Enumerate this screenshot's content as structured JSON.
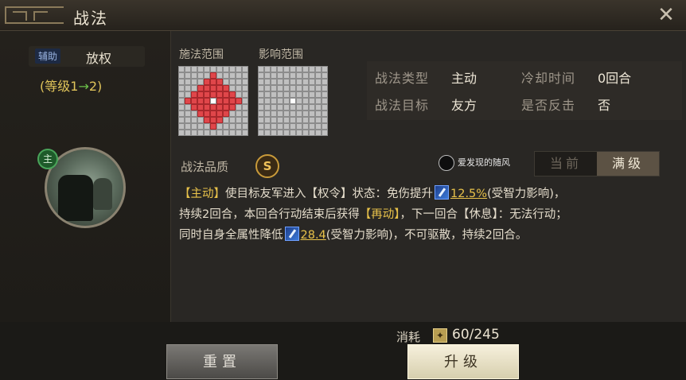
{
  "window": {
    "title": "战法",
    "close_icon": "close-icon"
  },
  "skill": {
    "type_badge": "辅助",
    "name": "放权",
    "level_prefix": "(等级1",
    "level_arrow": "→",
    "level_suffix": "2)",
    "leader_badge": "主"
  },
  "ranges": {
    "cast_label": "施法范围",
    "effect_label": "影响范围",
    "cast_grid_size": 11,
    "effect_grid_size": 11
  },
  "info": {
    "type_label": "战法类型",
    "type_value": "主动",
    "cooldown_label": "冷却时间",
    "cooldown_value": "0回合",
    "target_label": "战法目标",
    "target_value": "友方",
    "counter_label": "是否反击",
    "counter_value": "否"
  },
  "quality": {
    "label": "战法品质",
    "grade": "S"
  },
  "watermark": {
    "text": "爱发现的随风"
  },
  "level_toggle": {
    "current": "当前",
    "max": "满级",
    "selected": "满级"
  },
  "description": {
    "p1_tag": "【主动】",
    "p1_text": "使目标友军进入【权令】状态：免伤提升",
    "p1_value": "12.5%",
    "p1_after": "(受智力影响)，",
    "p2_text": "持续2回合，本回合行动结束后获得",
    "p2_tag": "【再动】",
    "p2_after": "，下一回合【休息】：无法行动；",
    "p3_text": "同时自身全属性降低",
    "p3_value": "28.4",
    "p3_after": "(受智力影响)，不可驱散，持续2回合。"
  },
  "cost": {
    "label": "消耗",
    "icon": "book-icon",
    "value": "60/245"
  },
  "buttons": {
    "reset": "重置",
    "upgrade": "升级"
  },
  "colors": {
    "accent": "#e8c24a",
    "range_red": "#e0464a",
    "leader_green": "#1e5a2a"
  }
}
